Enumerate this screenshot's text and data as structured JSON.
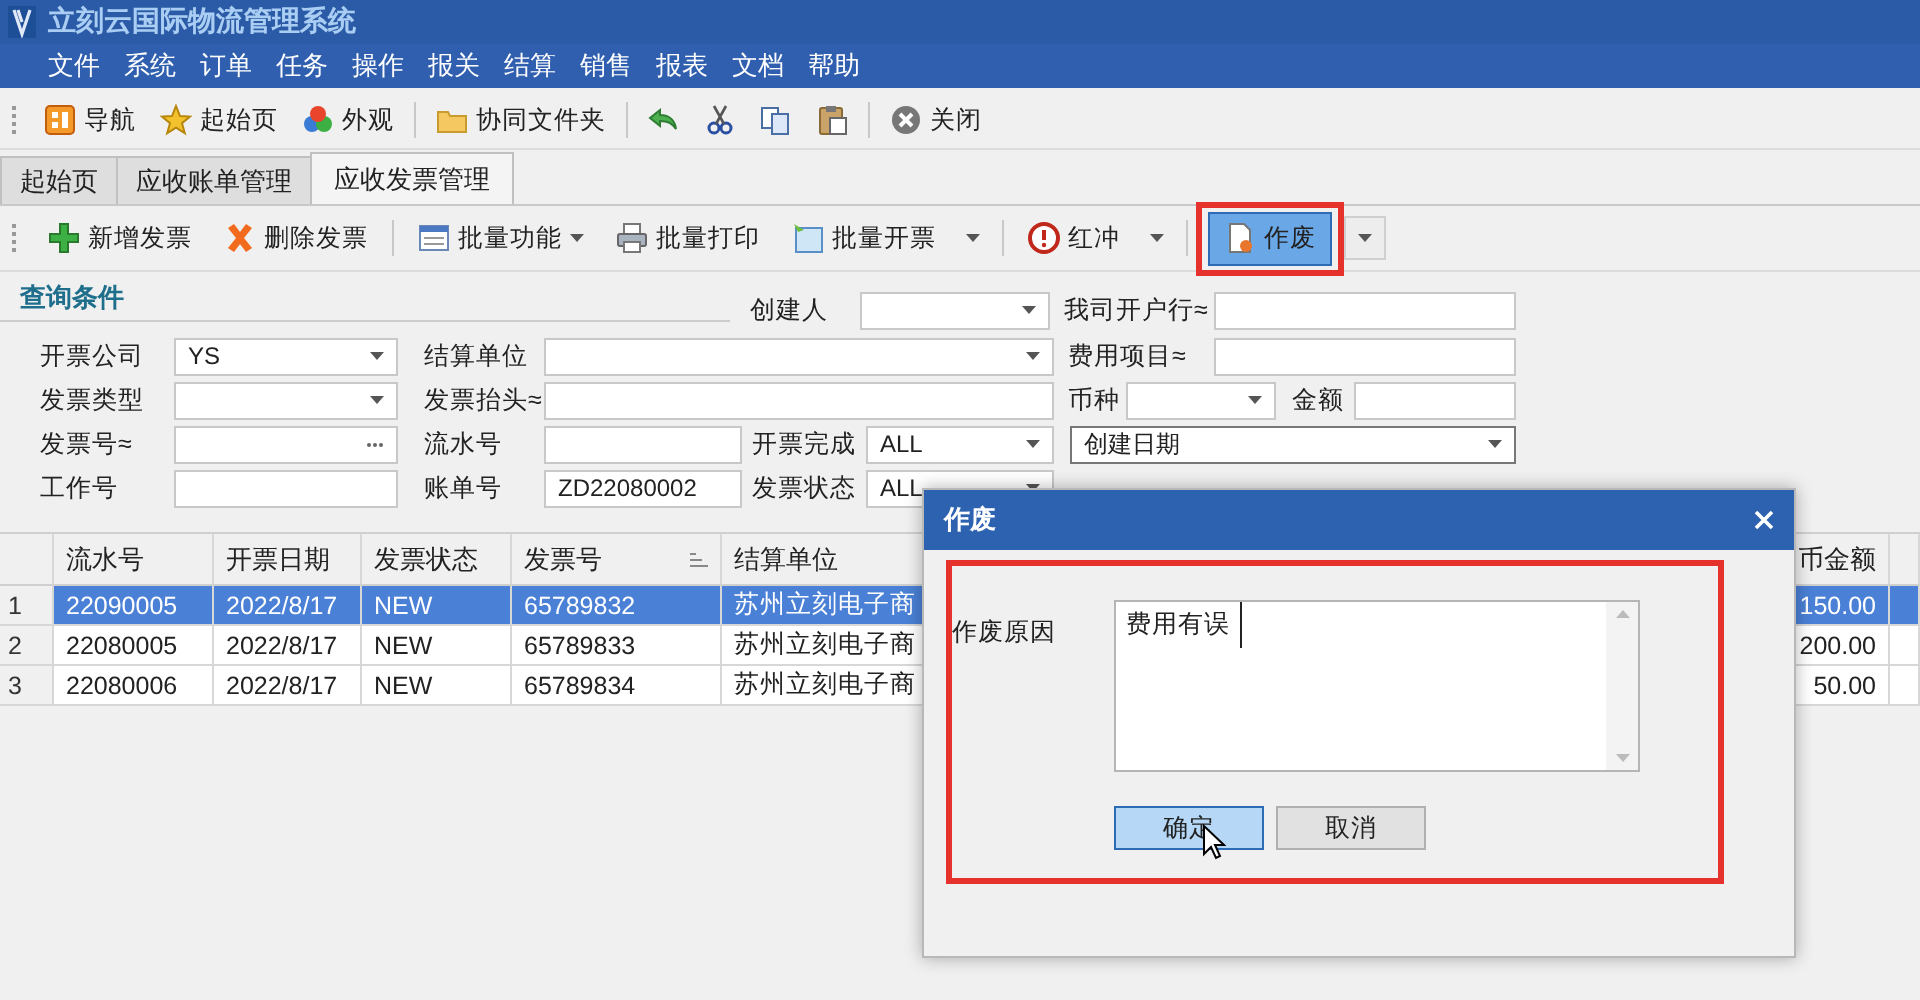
{
  "window": {
    "title": "立刻云国际物流管理系统"
  },
  "menu": [
    "文件",
    "系统",
    "订单",
    "任务",
    "操作",
    "报关",
    "结算",
    "销售",
    "报表",
    "文档",
    "帮助"
  ],
  "toolbar": {
    "groups": [
      {
        "items": [
          {
            "label": "导航"
          },
          {
            "label": "起始页"
          },
          {
            "label": "外观"
          }
        ]
      },
      {
        "items": [
          {
            "label": "协同文件夹"
          }
        ]
      },
      {
        "items": [
          {
            "label": "关闭"
          }
        ]
      }
    ]
  },
  "tabs": [
    {
      "label": "起始页",
      "selected": false
    },
    {
      "label": "应收账单管理",
      "selected": false
    },
    {
      "label": "应收发票管理",
      "selected": true
    }
  ],
  "actions": {
    "groups": [
      {
        "items": [
          {
            "label": "新增发票",
            "kind": "button",
            "active": false
          },
          {
            "label": "删除发票",
            "kind": "button",
            "active": false
          }
        ]
      },
      {
        "items": [
          {
            "label": "批量功能",
            "kind": "dropdown",
            "active": false
          },
          {
            "label": "批量打印",
            "kind": "button",
            "active": false
          },
          {
            "label": "批量开票",
            "kind": "split",
            "active": false
          }
        ]
      },
      {
        "items": [
          {
            "label": "红冲",
            "kind": "split",
            "active": false
          }
        ]
      },
      {
        "items": [
          {
            "label": "作废",
            "kind": "split",
            "active": true,
            "highlighted": true
          }
        ]
      }
    ]
  },
  "query": {
    "title": "查询条件",
    "rows": [
      [
        "",
        "",
        {
          "label": "创建人",
          "kind": "select"
        },
        {
          "label": "我司开户行≈",
          "kind": "input"
        }
      ],
      [
        {
          "label": "开票公司",
          "kind": "select",
          "value": "YS"
        },
        {
          "label": "结算单位",
          "kind": "select"
        },
        "",
        {
          "label": "费用项目≈",
          "kind": "input"
        }
      ],
      [
        {
          "label": "发票类型",
          "kind": "select"
        },
        {
          "label": "发票抬头≈",
          "kind": "input"
        },
        "",
        {
          "label": "币种",
          "kind": "select"
        },
        {
          "label": "金额",
          "kind": "input"
        }
      ],
      [
        {
          "label": "发票号≈",
          "kind": "picker"
        },
        {
          "label": "流水号",
          "kind": "input"
        },
        {
          "label": "开票完成",
          "kind": "select",
          "value": "ALL"
        },
        {
          "kind": "select",
          "value": "创建日期"
        }
      ],
      [
        {
          "label": "工作号",
          "kind": "input"
        },
        {
          "label": "账单号",
          "kind": "input",
          "value": "ZD22080002"
        },
        {
          "label": "发票状态",
          "kind": "select",
          "value": "ALL"
        }
      ]
    ]
  },
  "table": {
    "columns": [
      {
        "label": "流水号",
        "sorted": false
      },
      {
        "label": "开票日期",
        "sorted": false
      },
      {
        "label": "发票状态",
        "sorted": false
      },
      {
        "label": "发票号",
        "sorted": true
      },
      {
        "label": "结算单位",
        "sorted": false
      },
      {
        "label": "币金额",
        "sorted": false
      }
    ],
    "rows": [
      {
        "number": "1",
        "selected": true,
        "cells": [
          "22090005",
          "2022/8/17",
          "NEW",
          "65789832",
          "苏州立刻电子商",
          "150.00"
        ]
      },
      {
        "number": "2",
        "selected": false,
        "cells": [
          "22080005",
          "2022/8/17",
          "NEW",
          "65789833",
          "苏州立刻电子商",
          "200.00"
        ]
      },
      {
        "number": "3",
        "selected": false,
        "cells": [
          "22080006",
          "2022/8/17",
          "NEW",
          "65789834",
          "苏州立刻电子商",
          "50.00"
        ]
      }
    ]
  },
  "dialog": {
    "title": "作废",
    "highlighted": true,
    "reason_label": "作废原因",
    "reason_value": "费用有误",
    "buttons": [
      {
        "label": "确定",
        "focused": true
      },
      {
        "label": "取消",
        "focused": false
      }
    ]
  }
}
